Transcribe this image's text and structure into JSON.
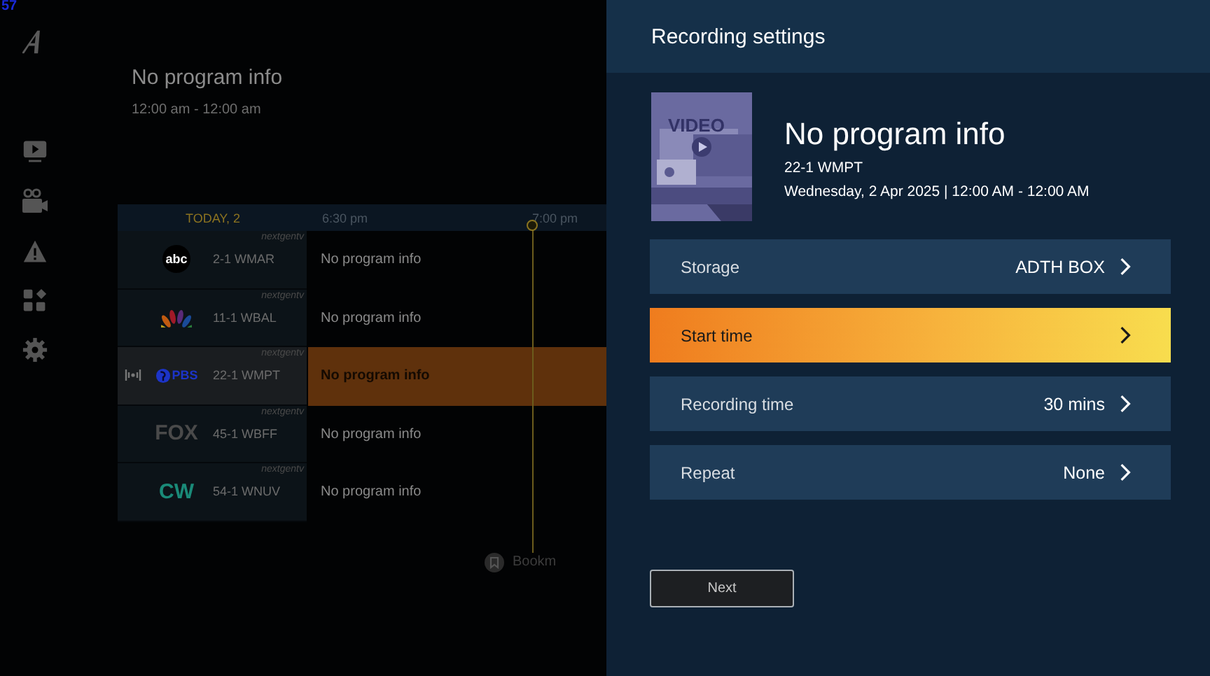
{
  "debug_label": "57",
  "now_playing": {
    "title": "No program info",
    "time": "12:00 am - 12:00 am"
  },
  "guide": {
    "date": "TODAY, 2",
    "times": [
      "6:30 pm",
      "7:00 pm"
    ],
    "channels": [
      {
        "kind": "disc",
        "logo": "abc",
        "color": "#ffffff",
        "badge": "nextgentv",
        "number": "2-1 WMAR",
        "program": "No program info",
        "selected": false
      },
      {
        "kind": "peacock",
        "badge": "nextgentv",
        "number": "11-1 WBAL",
        "program": "No program info",
        "selected": false
      },
      {
        "kind": "head",
        "logo": "PBS",
        "color": "#1c34c8",
        "badge": "nextgentv",
        "number": "22-1 WMPT",
        "program": "No program info",
        "selected": true
      },
      {
        "kind": "plain",
        "logo": "FOX",
        "color": "#4a4a4a",
        "badge": "nextgentv",
        "number": "45-1 WBFF",
        "program": "No program info",
        "selected": false
      },
      {
        "kind": "plain",
        "logo": "CW",
        "color": "#1a8a78",
        "badge": "nextgentv",
        "number": "54-1 WNUV",
        "program": "No program info",
        "selected": false
      }
    ]
  },
  "bookmark": "Bookm",
  "panel": {
    "title": "Recording settings",
    "thumbnail_label": "VIDEO",
    "program_title": "No program info",
    "channel": "22-1 WMPT",
    "airing": "Wednesday, 2 Apr 2025 | 12:00 AM - 12:00 AM",
    "settings": [
      {
        "label": "Storage",
        "value": "ADTH BOX",
        "selected": false
      },
      {
        "label": "Start time",
        "selected": true
      },
      {
        "label": "Recording time",
        "value": "30 mins",
        "selected": false
      },
      {
        "label": "Repeat",
        "value": "None",
        "selected": false
      }
    ],
    "next_button": "Next"
  }
}
